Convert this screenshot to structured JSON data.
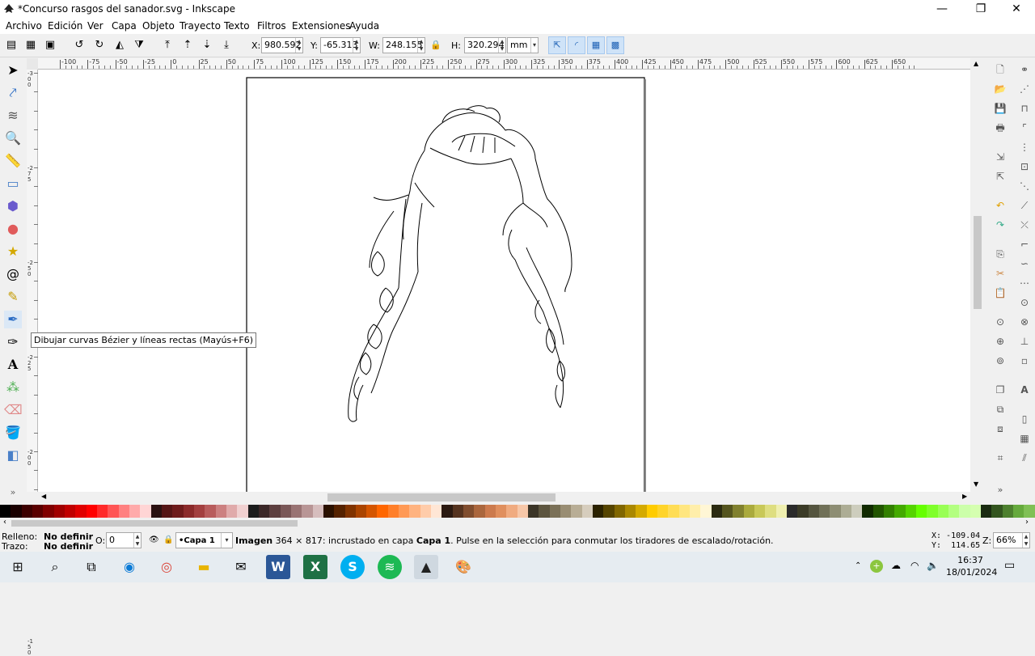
{
  "window": {
    "title": "*Concurso rasgos del sanador.svg - Inkscape",
    "minimize": "—",
    "restore": "❐",
    "close": "✕"
  },
  "menu": [
    "Archivo",
    "Edición",
    "Ver",
    "Capa",
    "Objeto",
    "Trayecto",
    "Texto",
    "Filtros",
    "Extensiones",
    "Ayuda"
  ],
  "toolbar": {
    "x_label": "X:",
    "x_value": "980.592",
    "y_label": "Y:",
    "y_value": "-65.313",
    "w_label": "W:",
    "w_value": "248.155",
    "h_label": "H:",
    "h_value": "320.294",
    "unit": "mm"
  },
  "ruler": {
    "top_labels": [
      "-100",
      "-75",
      "-50",
      "-25",
      "0",
      "25",
      "50",
      "75",
      "100",
      "125",
      "150",
      "175",
      "200",
      "225",
      "250",
      "275",
      "300",
      "325",
      "350",
      "375",
      "400",
      "425",
      "450",
      "475",
      "500",
      "525",
      "550",
      "575",
      "600",
      "625",
      "650"
    ],
    "left_labels": [
      "-300",
      "-275",
      "-250",
      "-225",
      "-200",
      "-175",
      "-150"
    ]
  },
  "tooltip": "Dibujar curvas Bézier y líneas rectas (Mayús+F6)",
  "status": {
    "fill_label": "Relleno:",
    "fill_value": "No definir",
    "stroke_label": "Trazo:",
    "stroke_value": "No definir",
    "opacity_label": "O:",
    "opacity_value": "0",
    "layer": "•Capa 1",
    "msg_bold1": "Imagen",
    "msg_1": " 364 × 817: incrustado en capa ",
    "msg_bold2": "Capa 1",
    "msg_2": ". Pulse en la selección para conmutar los tiradores de escalado/rotación.",
    "cursor_x": "X: -109.04",
    "cursor_y": "Y:  114.65",
    "zoom_label": "Z:",
    "zoom_value": "66%"
  },
  "taskbar": {
    "time": "16:37",
    "date": "18/01/2024"
  },
  "colors": {
    "palette": [
      "#000000",
      "#1a0000",
      "#3d0000",
      "#5a0000",
      "#800000",
      "#a00000",
      "#c00000",
      "#e00000",
      "#ff0000",
      "#ff2a2a",
      "#ff5555",
      "#ff8080",
      "#ffaaaa",
      "#ffd5d5",
      "#2b1111",
      "#551515",
      "#6e1b1b",
      "#8b2a2a",
      "#a33f3f",
      "#b85c5c",
      "#cc8080",
      "#e0aaaa",
      "#f0d0d0",
      "#1c1c1c",
      "#3b2727",
      "#5d3f3f",
      "#7a5757",
      "#997373",
      "#b89595",
      "#d6bdbd",
      "#2b1100",
      "#552200",
      "#803300",
      "#aa4400",
      "#d45500",
      "#ff6600",
      "#ff7f2a",
      "#ff9955",
      "#ffb380",
      "#ffccaa",
      "#ffe6d5",
      "#2b1a11",
      "#55331f",
      "#804d2e",
      "#aa663d",
      "#cc7a4d",
      "#e08f5e",
      "#f0ab80",
      "#f7c7a8",
      "#3b3527",
      "#5d553f",
      "#7a7057",
      "#998d73",
      "#b8ad95",
      "#d6cdbd",
      "#2b2200",
      "#554400",
      "#806600",
      "#aa8800",
      "#d4aa00",
      "#ffcc00",
      "#ffd42a",
      "#ffdd55",
      "#ffe680",
      "#ffeeaa",
      "#fff6d5",
      "#2b2b11",
      "#55551f",
      "#80802e",
      "#aaaa3d",
      "#c8c858",
      "#dede80",
      "#efefb0",
      "#2b2b2b",
      "#3b3b27",
      "#55553f",
      "#707057",
      "#8d8d73",
      "#adad95",
      "#cdcdbd",
      "#112b00",
      "#225500",
      "#338000",
      "#44aa00",
      "#55d400",
      "#66ff00",
      "#7fff2a",
      "#99ff55",
      "#b3ff80",
      "#ccffaa",
      "#d5ffb0",
      "#1a2b11",
      "#33551f",
      "#4d802e",
      "#66aa3d",
      "#80c055"
    ]
  }
}
